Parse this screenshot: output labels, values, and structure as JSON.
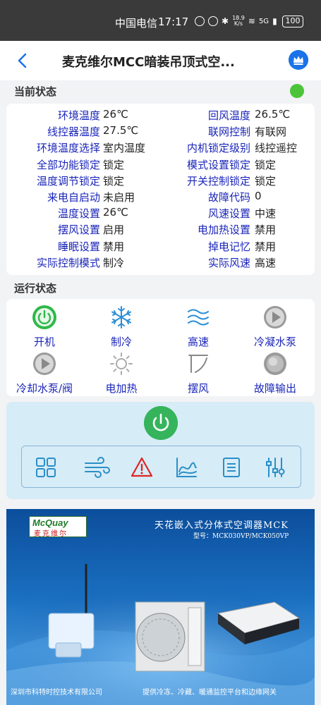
{
  "statusbar": {
    "carrier": "中国电信",
    "time": "17:17",
    "speed_value": "18.9",
    "speed_unit": "K/s",
    "signal": "5G",
    "battery": "100"
  },
  "header": {
    "title": "麦克维尔MCC暗装吊顶式空..."
  },
  "current_status": {
    "title": "当前状态",
    "indicator_color": "#4cc43a",
    "rows": [
      [
        {
          "label": "环境温度",
          "value": "26℃"
        },
        {
          "label": "回风温度",
          "value": "26.5℃"
        }
      ],
      [
        {
          "label": "线控器温度",
          "value": "27.5℃"
        },
        {
          "label": "联网控制",
          "value": "有联网"
        }
      ],
      [
        {
          "label": "环境温度选择",
          "value": "室内温度"
        },
        {
          "label": "内机锁定级别",
          "value": "线控遥控"
        }
      ],
      [
        {
          "label": "全部功能锁定",
          "value": "锁定"
        },
        {
          "label": "模式设置锁定",
          "value": "锁定"
        }
      ],
      [
        {
          "label": "温度调节锁定",
          "value": "锁定"
        },
        {
          "label": "开关控制锁定",
          "value": "锁定"
        }
      ],
      [
        {
          "label": "来电自启动",
          "value": "未启用"
        },
        {
          "label": "故障代码",
          "value": "0"
        }
      ],
      [
        {
          "label": "温度设置",
          "value": "26℃"
        },
        {
          "label": "风速设置",
          "value": "中速"
        }
      ],
      [
        {
          "label": "摆风设置",
          "value": "启用"
        },
        {
          "label": "电加热设置",
          "value": "禁用"
        }
      ],
      [
        {
          "label": "睡眠设置",
          "value": "禁用"
        },
        {
          "label": "掉电记忆",
          "value": "禁用"
        }
      ],
      [
        {
          "label": "实际控制模式",
          "value": "制冷"
        },
        {
          "label": "实际风速",
          "value": "高速"
        }
      ]
    ]
  },
  "run_status": {
    "title": "运行状态",
    "items": [
      {
        "label": "开机",
        "icon": "power-on-icon"
      },
      {
        "label": "制冷",
        "icon": "snowflake-icon"
      },
      {
        "label": "高速",
        "icon": "wind-high-icon"
      },
      {
        "label": "冷凝水泵",
        "icon": "pump-icon"
      },
      {
        "label": "冷却水泵/阀",
        "icon": "pump-icon"
      },
      {
        "label": "电加热",
        "icon": "sun-icon"
      },
      {
        "label": "摆风",
        "icon": "swing-icon"
      },
      {
        "label": "故障输出",
        "icon": "fault-icon"
      }
    ]
  },
  "control": {
    "power": "power-button",
    "tools": [
      "grid-icon",
      "wind-icon",
      "warning-icon",
      "chart-icon",
      "list-icon",
      "settings-icon"
    ]
  },
  "banner": {
    "brand": "McQuay",
    "brand_cn": "麦克维尔",
    "title": "天花嵌入式分体式空调器MCK",
    "model": "型号：MCK030VP/MCK050VP",
    "footer_left": "深圳市科特时控技术有限公司",
    "footer_right": "提供冷冻、冷藏、暖通监控平台和边缘网关"
  }
}
